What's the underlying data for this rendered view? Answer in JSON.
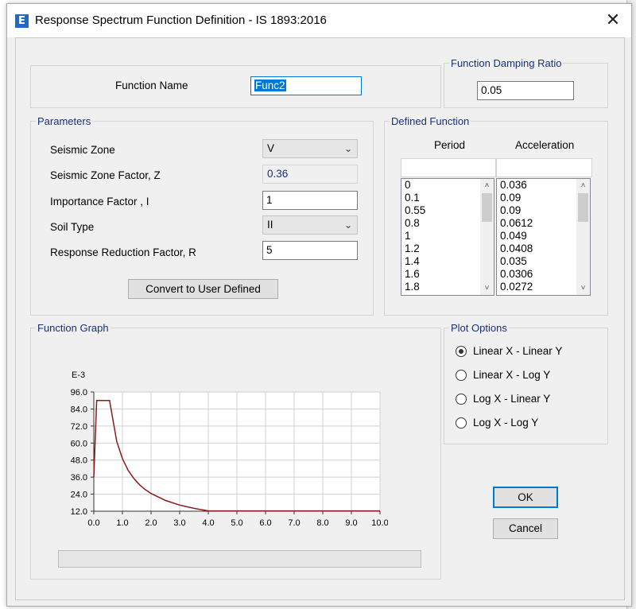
{
  "window": {
    "title": "Response Spectrum Function Definition - IS 1893:2016",
    "app_icon_glyph": "E",
    "close_glyph": "✕"
  },
  "function_name": {
    "label": "Function Name",
    "value": "Func2"
  },
  "damping": {
    "legend": "Function Damping Ratio",
    "value": "0.05"
  },
  "parameters": {
    "legend": "Parameters",
    "seismic_zone": {
      "label": "Seismic Zone",
      "value": "V"
    },
    "zone_factor": {
      "label": "Seismic Zone Factor, Z",
      "value": "0.36"
    },
    "importance": {
      "label": "Importance Factor , I",
      "value": "1"
    },
    "soil_type": {
      "label": "Soil Type",
      "value": "II"
    },
    "reduction": {
      "label": "Response Reduction Factor, R",
      "value": "5"
    },
    "convert_button": "Convert to User Defined"
  },
  "defined_function": {
    "legend": "Defined Function",
    "period_header": "Period",
    "acceleration_header": "Acceleration",
    "periods": [
      "0",
      "0.1",
      "0.55",
      "0.8",
      "1",
      "1.2",
      "1.4",
      "1.6",
      "1.8"
    ],
    "accelerations": [
      "0.036",
      "0.09",
      "0.09",
      "0.0612",
      "0.049",
      "0.0408",
      "0.035",
      "0.0306",
      "0.0272"
    ]
  },
  "graph": {
    "legend": "Function Graph"
  },
  "plot_options": {
    "legend": "Plot Options",
    "options": [
      "Linear X - Linear Y",
      "Linear X - Log Y",
      "Log X - Linear Y",
      "Log X - Log Y"
    ],
    "selected_index": 0
  },
  "buttons": {
    "ok": "OK",
    "cancel": "Cancel"
  },
  "icons": [
    "app-icon",
    "close-icon",
    "chevron-down-icon",
    "scroll-up-icon",
    "scroll-down-icon"
  ],
  "colors": {
    "legend_text": "#1a2f7a",
    "curve": "#8b1a1a",
    "ok_border": "#0078d7"
  },
  "chart_data": {
    "type": "line",
    "ylabel": "E-3",
    "xlim": [
      0,
      10
    ],
    "ylim": [
      12,
      96
    ],
    "x_ticks": [
      "0.0",
      "1.0",
      "2.0",
      "3.0",
      "4.0",
      "5.0",
      "6.0",
      "7.0",
      "8.0",
      "9.0",
      "10.0"
    ],
    "y_ticks": [
      "12.0",
      "24.0",
      "36.0",
      "48.0",
      "60.0",
      "72.0",
      "84.0",
      "96.0"
    ],
    "grid": true,
    "x": [
      0,
      0.1,
      0.55,
      0.8,
      1,
      1.2,
      1.4,
      1.6,
      1.8,
      2.0,
      2.5,
      3.0,
      3.5,
      4.0,
      10.0
    ],
    "y": [
      36,
      90,
      90,
      61.2,
      49,
      40.8,
      35,
      30.6,
      27.2,
      24.5,
      19.6,
      16.3,
      14,
      12.2,
      12.2
    ]
  }
}
